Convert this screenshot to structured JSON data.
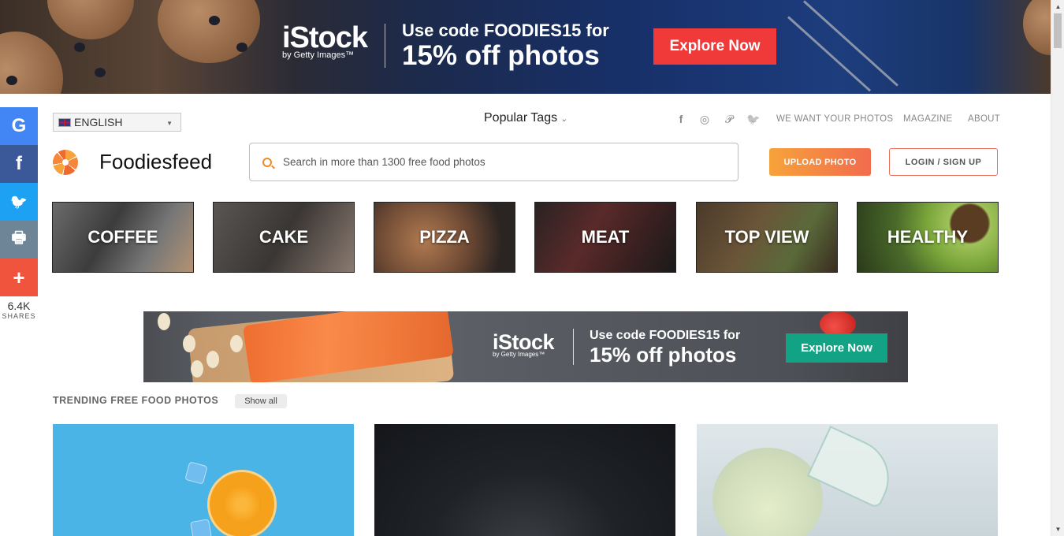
{
  "top_banner": {
    "brand": "iStock",
    "brand_sub": "by Getty Images™",
    "line1": "Use code FOODIES15 for",
    "line2": "15% off photos",
    "cta": "Explore Now"
  },
  "share_bar": {
    "buttons": [
      {
        "name": "google",
        "glyph": "G",
        "color": "#4285f4"
      },
      {
        "name": "facebook",
        "glyph": "f",
        "color": "#3b5998"
      },
      {
        "name": "twitter",
        "glyph": "🐦",
        "color": "#1da1f2"
      },
      {
        "name": "print",
        "glyph": "🖶",
        "color": "#6d8596"
      },
      {
        "name": "more",
        "glyph": "+",
        "color": "#f0543c"
      }
    ],
    "count": "6.4K",
    "count_label": "SHARES"
  },
  "header": {
    "language": "ENGLISH",
    "popular_tags": "Popular Tags",
    "popular_chevron": "⌄",
    "social_icons": [
      "f",
      "◎",
      "𝒫",
      "🐦"
    ],
    "links": [
      "WE WANT YOUR PHOTOS",
      "MAGAZINE",
      "ABOUT"
    ],
    "logo_text": "Foodiesfeed",
    "search_placeholder": "Search in more than 1300 free food photos",
    "upload_label": "UPLOAD PHOTO",
    "login_label": "LOGIN / SIGN UP"
  },
  "categories": [
    {
      "label": "COFFEE"
    },
    {
      "label": "CAKE"
    },
    {
      "label": "PIZZA"
    },
    {
      "label": "MEAT"
    },
    {
      "label": "TOP VIEW"
    },
    {
      "label": "HEALTHY"
    }
  ],
  "mid_banner": {
    "brand": "iStock",
    "brand_sub": "by Getty Images™",
    "line1": "Use code FOODIES15 for",
    "line2": "15% off photos",
    "cta": "Explore Now"
  },
  "trending": {
    "title": "TRENDING FREE FOOD PHOTOS",
    "show_all": "Show all"
  },
  "colors": {
    "accent_orange": "#f6a33b",
    "accent_red": "#f03a3a",
    "accent_green": "#12a384"
  }
}
